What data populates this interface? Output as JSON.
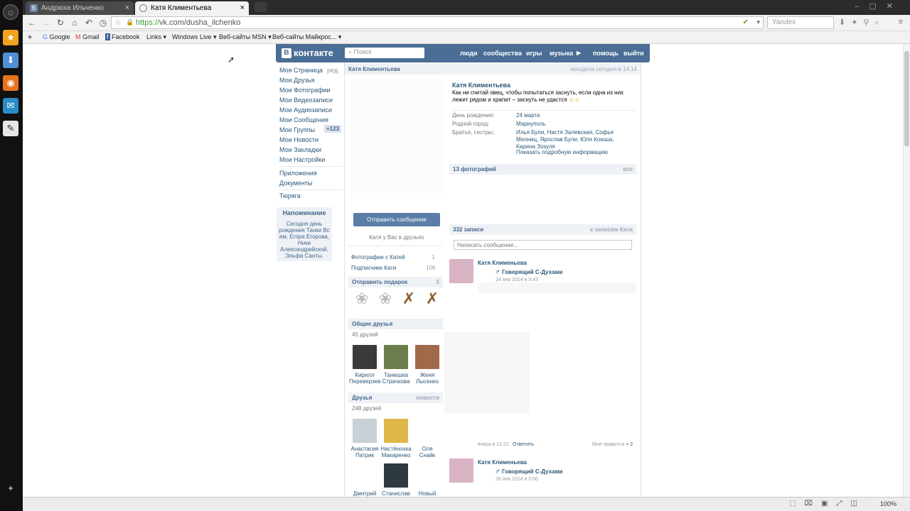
{
  "browser": {
    "tabs": [
      {
        "title": "Андрюха Ильченко",
        "active": false
      },
      {
        "title": "Катя Климентьева",
        "active": true
      }
    ],
    "url_scheme": "https://",
    "url_rest": "vk.com/dusha_ilchenko",
    "search_placeholder": "Yandex",
    "bookmarks": [
      "Google",
      "Gmail",
      "Facebook",
      "Links",
      "Windows Live",
      "Веб-сайты MSN",
      "Веб-сайты Майкрос..."
    ],
    "zoom": "100%"
  },
  "vk": {
    "logo": "контакте",
    "search_placeholder": "Поиск",
    "nav": [
      "люди",
      "сообщества",
      "игры",
      "музыка",
      "помощь",
      "выйти"
    ],
    "menu": [
      {
        "label": "Моя Страница",
        "extra": "ред."
      },
      {
        "label": "Мои Друзья"
      },
      {
        "label": "Мои Фотографии"
      },
      {
        "label": "Мои Видеозаписи"
      },
      {
        "label": "Мои Аудиозаписи"
      },
      {
        "label": "Мои Сообщения"
      },
      {
        "label": "Мои Группы",
        "extra": "+123"
      },
      {
        "label": "Мои Новости"
      },
      {
        "label": "Мои Закладки"
      },
      {
        "label": "Мои Настройки"
      },
      {
        "label": "Приложения"
      },
      {
        "label": "Документы"
      },
      {
        "label": "Тюряга"
      }
    ],
    "reminder": {
      "title": "Напоминание",
      "text": "Сегодня день рождения Танки Вс ем, Егора Егорова, Ники Александрийской, Эльфа Санты."
    }
  },
  "profile": {
    "header_name": "Катя Климентьева",
    "header_status": "заходила сегодня в 14:14",
    "name": "Катя Климентьева",
    "status": "Как ни считай овец, чтобы попытаться заснуть, если одна из них лежит рядом и храпит – заснуть не удастся",
    "info": [
      {
        "label": "День рождения:",
        "value": "24 марта"
      },
      {
        "label": "Родной город:",
        "value": "Мариуполь"
      },
      {
        "label": "Братья, сестры:",
        "value": "Илья Були, Настя Залевская, Софья Мелниц, Ярослав Були, Юля Коюша, Карина Зозуля"
      }
    ],
    "show_more": "Показать подробную информацию",
    "send_message": "Отправить сообщение",
    "in_friends": "Катя у Вас в друзьях",
    "photos_with": "Фотографии с Катей",
    "photos_with_count": "1",
    "subscribers": "Подписчики Кати",
    "subscribers_count": "106",
    "gift_title": "Отправить подарок",
    "gift_count": "5",
    "common_title": "Общие друзья",
    "common_count": "45 друзей",
    "common_friends": [
      {
        "first": "Кирилл",
        "last": "Переверзев"
      },
      {
        "first": "Танюшка",
        "last": "Страчкова"
      },
      {
        "first": "Женя",
        "last": "Лысенко"
      }
    ],
    "friends_title": "Друзья",
    "friends_news": "новости",
    "friends_count": "248 друзей",
    "friends": [
      {
        "first": "Анастасия",
        "last": "Патрик"
      },
      {
        "first": "Настёночка",
        "last": "Макаренко"
      },
      {
        "first": "Оля",
        "last": "Снайк"
      },
      {
        "first": "Дмитрий",
        "last": ""
      },
      {
        "first": "Станислав",
        "last": ""
      },
      {
        "first": "Новый",
        "last": ""
      }
    ],
    "photos_title": "13 фотографий",
    "photos_all": "все",
    "wall_title": "332 записи",
    "wall_link": "к записям Кати",
    "wall_placeholder": "Написать сообщение...",
    "posts": [
      {
        "author": "Катя Клименьева",
        "repost": "Говорящий С-Духами",
        "date": "24 янв 2014 в 9:43"
      },
      {
        "author": "Катя Клименьева",
        "repost": "Говорящий С-Духами",
        "date": "26 янв 2014 в 0:06"
      }
    ],
    "post_footer_date": "вчера в 21:21",
    "post_footer_reply": "Ответить",
    "post_footer_like": "Мне нравится",
    "post_footer_like_count": "2"
  }
}
